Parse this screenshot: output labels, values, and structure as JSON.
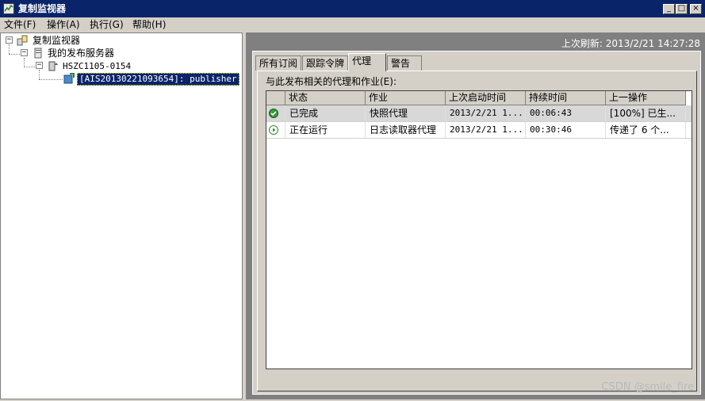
{
  "window": {
    "title": "复制监视器"
  },
  "menu": {
    "items": [
      "文件(F)",
      "操作(A)",
      "执行(G)",
      "帮助(H)"
    ]
  },
  "tree": {
    "root": "复制监视器",
    "publishers_node": "我的发布服务器",
    "server": "HSZC1105-0154",
    "publication": "[AIS20130221093654]: publisher"
  },
  "refresh_text": "上次刷新: 2013/2/21 14:27:28",
  "tabs": [
    "所有订阅",
    "跟踪令牌",
    "代理",
    "警告"
  ],
  "active_tab": "代理",
  "panel": {
    "caption": "与此发布相关的代理和作业(E):",
    "columns": [
      "状态",
      "作业",
      "上次启动时间",
      "持续时间",
      "上一操作"
    ],
    "rows": [
      {
        "status_icon": "check-circle-icon",
        "status": "已完成",
        "job": "快照代理",
        "start": "2013/2/21 1...",
        "duration": "00:06:43",
        "last_action": "[100%] 已生..."
      },
      {
        "status_icon": "play-circle-icon",
        "status": "正在运行",
        "job": "日志读取器代理",
        "start": "2013/2/21 1...",
        "duration": "00:30:46",
        "last_action": "传递了 6 个..."
      }
    ]
  },
  "watermark": "CSDN @smile_fire",
  "colors": {
    "titlebar": "#0a246a",
    "selection": "#0a246a",
    "ok": "#3a9a3a",
    "running": "#2f8f2f"
  }
}
